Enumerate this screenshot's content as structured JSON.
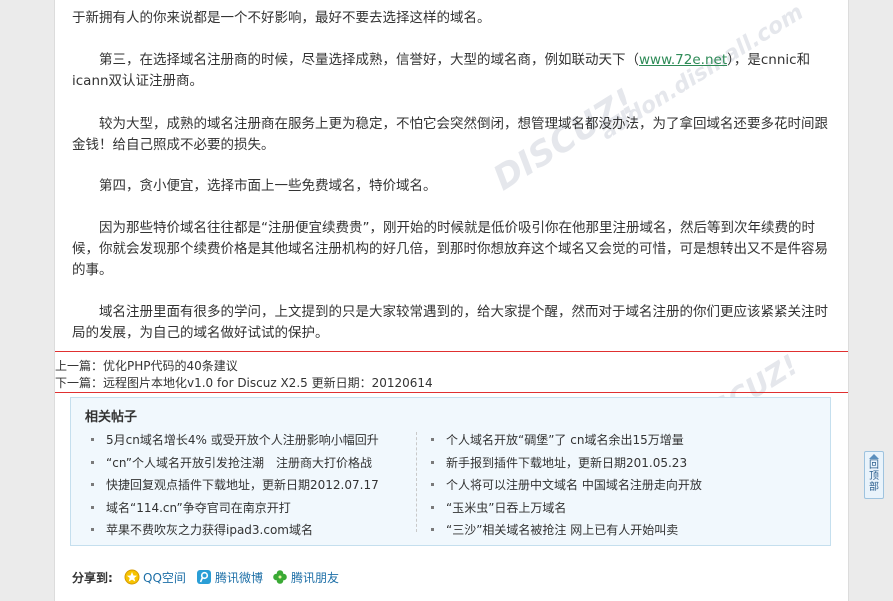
{
  "article": {
    "top_fragment": "于新拥有人的你来说都是一个不好影响，最好不要去选择这样的域名。",
    "p3_before": "第三，在选择域名注册商的时候，尽量选择成熟，信誉好，大型的域名商，例如联动天下（",
    "p3_link": "www.72e.net",
    "p3_after": "），是cnnic和icann双认证注册商。",
    "p4": "较为大型，成熟的域名注册商在服务上更为稳定，不怕它会突然倒闭，想管理域名都没办法，为了拿回域名还要多花时间跟金钱！给自己照成不必要的损失。",
    "p5": "第四，贪小便宜，选择市面上一些免费域名，特价域名。",
    "p6": "因为那些特价域名往往都是“注册便宜续费贵”，刚开始的时候就是低价吸引你在他那里注册域名，然后等到次年续费的时候，你就会发现那个续费价格是其他域名注册机构的好几倍，到那时你想放弃这个域名又会觉的可惜，可是想转出又不是件容易的事。",
    "p7": "域名注册里面有很多的学问，上文提到的只是大家较常遇到的，给大家提个醒，然而对于域名注册的你们更应该紧紧关注时局的发展，为自己的域名做好试试的保护。"
  },
  "nav": {
    "prev": "上一篇：优化PHP代码的40条建议",
    "next": "下一篇：远程图片本地化v1.0 for Discuz X2.5 更新日期：20120614"
  },
  "related": {
    "title": "相关帖子",
    "left": [
      "5月cn域名增长4% 或受开放个人注册影响小幅回升",
      "“cn”个人域名开放引发抢注潮　注册商大打价格战",
      "快捷回复观点插件下载地址，更新日期2012.07.17",
      "域名“114.cn”争夺官司在南京开打",
      "苹果不费吹灰之力获得ipad3.com域名"
    ],
    "right": [
      "个人域名开放“碉堡”了 cn域名余出15万增量",
      "新手报到插件下载地址，更新日期201.05.23",
      "个人将可以注册中文域名 中国域名注册走向开放",
      "“玉米虫”日吞上万域名",
      "“三沙”相关域名被抢注 网上已有人开始叫卖"
    ]
  },
  "share": {
    "label": "分享到:",
    "items": [
      {
        "label": "QQ空间",
        "icon": "qzone-icon"
      },
      {
        "label": "腾讯微博",
        "icon": "tencent-weibo-icon"
      },
      {
        "label": "腾讯朋友",
        "icon": "tencent-pengyou-icon"
      }
    ]
  },
  "back_to_top": {
    "label": "回顶部",
    "icon": "arrow-up-icon"
  },
  "colors": {
    "link_green": "#2e8b57",
    "highlight_red": "#e03030",
    "related_bg": "#f1f8fd",
    "related_border": "#c5dfee",
    "share_link": "#1d6fa7"
  }
}
